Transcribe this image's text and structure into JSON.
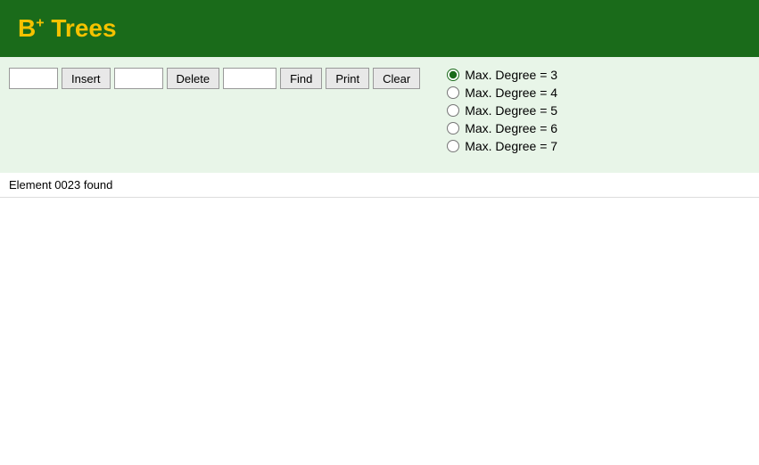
{
  "header": {
    "title": "Trees",
    "title_prefix": "B",
    "title_superscript": "+"
  },
  "toolbar": {
    "insert_label": "Insert",
    "delete_label": "Delete",
    "find_label": "Find",
    "print_label": "Print",
    "clear_label": "Clear",
    "insert_placeholder": "",
    "delete_placeholder": "",
    "find_placeholder": ""
  },
  "radio_options": [
    {
      "label": "Max. Degree = 3",
      "value": "3",
      "checked": true
    },
    {
      "label": "Max. Degree = 4",
      "value": "4",
      "checked": false
    },
    {
      "label": "Max. Degree = 5",
      "value": "5",
      "checked": false
    },
    {
      "label": "Max. Degree = 6",
      "value": "6",
      "checked": false
    },
    {
      "label": "Max. Degree = 7",
      "value": "7",
      "checked": false
    }
  ],
  "status": {
    "message": "Element 0023 found"
  }
}
